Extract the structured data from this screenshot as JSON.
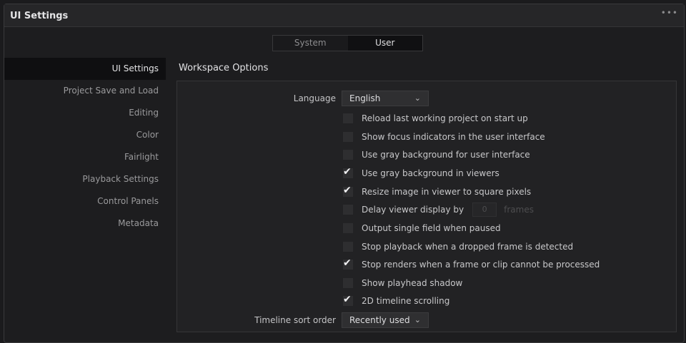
{
  "window": {
    "title": "UI Settings",
    "more_glyph": "•••"
  },
  "tabs": [
    {
      "label": "System",
      "active": false
    },
    {
      "label": "User",
      "active": true
    }
  ],
  "sidebar": {
    "items": [
      {
        "label": "UI Settings",
        "active": true
      },
      {
        "label": "Project Save and Load",
        "active": false
      },
      {
        "label": "Editing",
        "active": false
      },
      {
        "label": "Color",
        "active": false
      },
      {
        "label": "Fairlight",
        "active": false
      },
      {
        "label": "Playback Settings",
        "active": false
      },
      {
        "label": "Control Panels",
        "active": false
      },
      {
        "label": "Metadata",
        "active": false
      }
    ]
  },
  "workspace": {
    "title": "Workspace Options",
    "language": {
      "label": "Language",
      "value": "English"
    },
    "options": [
      {
        "label": "Reload last working project on start up",
        "checked": false
      },
      {
        "label": "Show focus indicators in the user interface",
        "checked": false
      },
      {
        "label": "Use gray background for user interface",
        "checked": false
      },
      {
        "label": "Use gray background in viewers",
        "checked": true
      },
      {
        "label": "Resize image in viewer to square pixels",
        "checked": true
      },
      {
        "label": "Delay viewer display by",
        "checked": false
      },
      {
        "label": "Output single field when paused",
        "checked": false
      },
      {
        "label": "Stop playback when a dropped frame is detected",
        "checked": false
      },
      {
        "label": "Stop renders when a frame or clip cannot be processed",
        "checked": true
      },
      {
        "label": "Show playhead shadow",
        "checked": false
      },
      {
        "label": "2D timeline scrolling",
        "checked": true
      }
    ],
    "delay": {
      "value": "0",
      "unit": "frames"
    },
    "sort_order": {
      "label": "Timeline sort order",
      "value": "Recently used"
    }
  },
  "icons": {
    "check": "checkmark-icon",
    "chevron": "chevron-down-icon",
    "more": "more-icon"
  },
  "colors": {
    "panel_bg": "#222224",
    "window_bg": "#1d1d1f",
    "active_item_bg": "#0f0f11"
  }
}
